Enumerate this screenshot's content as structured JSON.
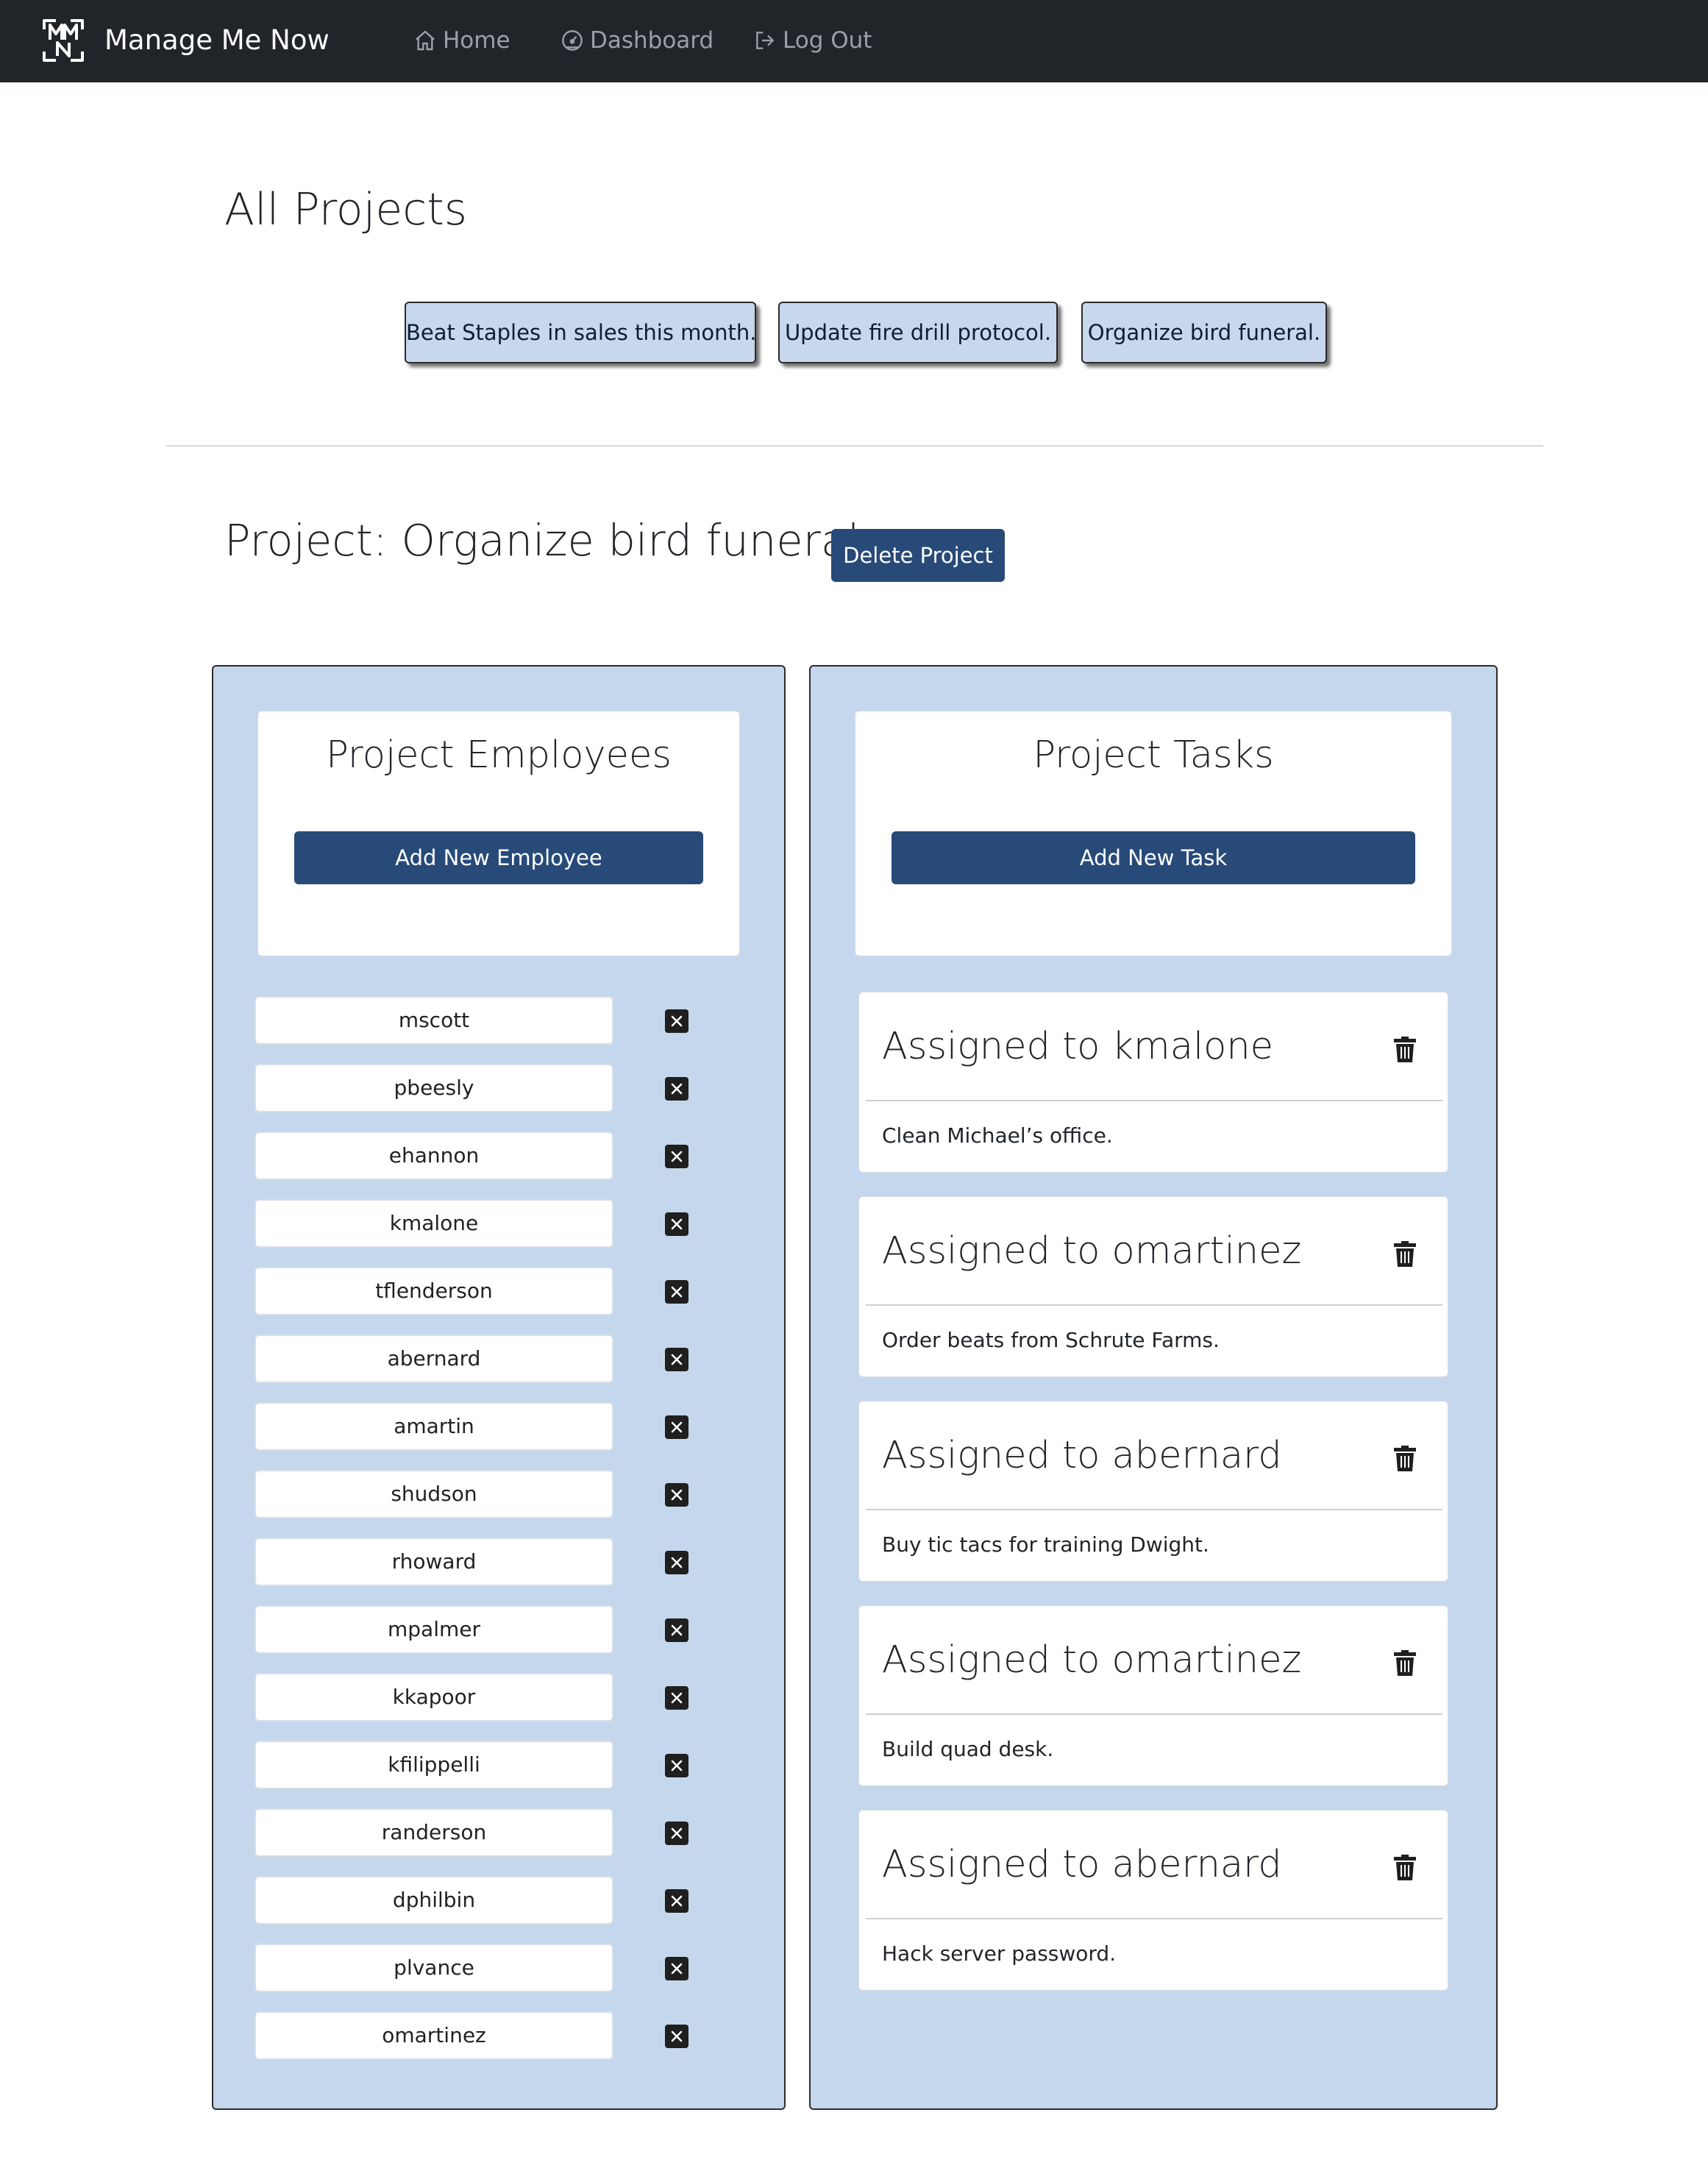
{
  "nav": {
    "brand": "Manage Me Now",
    "logo_icon": "mnm-logo",
    "links": [
      {
        "label": "Home",
        "icon": "home-icon"
      },
      {
        "label": "Dashboard",
        "icon": "dashboard-icon"
      },
      {
        "label": "Log Out",
        "icon": "logout-icon"
      }
    ]
  },
  "all_projects": {
    "heading": "All Projects",
    "projects": [
      "Beat Staples in sales this month.",
      "Update fire drill protocol.",
      "Organize bird funeral."
    ]
  },
  "project": {
    "heading": "Project: Organize bird funeral.",
    "delete_label": "Delete Project"
  },
  "employees": {
    "title": "Project Employees",
    "add_label": "Add New Employee",
    "list": [
      "mscott",
      "pbeesly",
      "ehannon",
      "kmalone",
      "tflenderson",
      "abernard",
      "amartin",
      "shudson",
      "rhoward",
      "mpalmer",
      "kkapoor",
      "kfilippelli",
      "randerson",
      "dphilbin",
      "plvance",
      "omartinez"
    ]
  },
  "tasks": {
    "title": "Project Tasks",
    "add_label": "Add New Task",
    "list": [
      {
        "assignee": "Assigned to kmalone",
        "description": "Clean Michael’s office."
      },
      {
        "assignee": "Assigned to omartinez",
        "description": "Order beats from Schrute Farms."
      },
      {
        "assignee": "Assigned to abernard",
        "description": "Buy tic tacs for training Dwight."
      },
      {
        "assignee": "Assigned to omartinez",
        "description": "Build quad desk."
      },
      {
        "assignee": "Assigned to abernard",
        "description": "Hack server password."
      }
    ]
  },
  "colors": {
    "navbar": "#212529",
    "panel": "#c5d7ec",
    "primary_button": "#274a78",
    "project_button": "#c7d7ed"
  }
}
